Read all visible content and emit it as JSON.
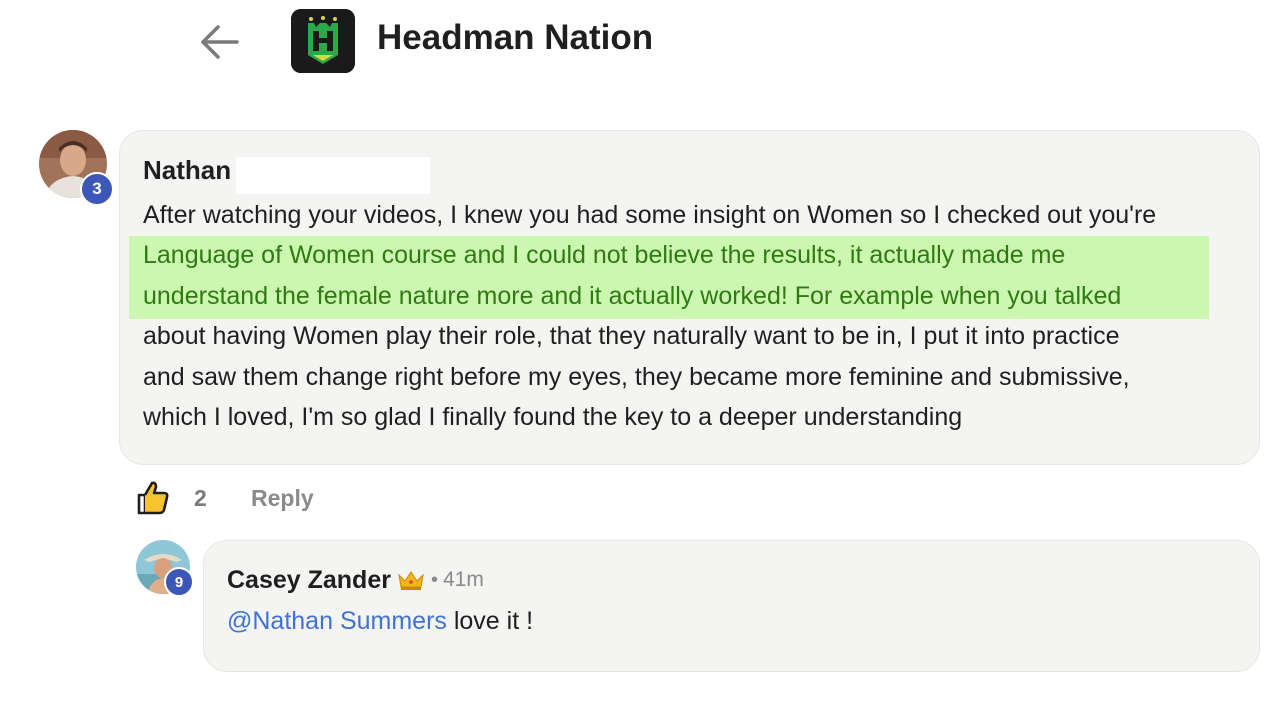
{
  "header": {
    "back_icon": "arrow-left-icon",
    "group_logo_icon": "headman-nation-logo",
    "title": "Headman Nation"
  },
  "comment": {
    "author": "Nathan",
    "level": "3",
    "lines": [
      {
        "text": "After watching your videos, I knew you had some insight on Women so I checked out you're",
        "highlighted": false
      },
      {
        "text": "Language of Women course and I could not believe the results, it actually made me",
        "highlighted": true
      },
      {
        "text": "understand the female nature more and it actually worked! For example when you talked",
        "highlighted": true
      },
      {
        "text": "about having Women play their role, that they naturally want to be in, I put it into practice",
        "highlighted": false
      },
      {
        "text": "and saw them change right before my eyes, they became more feminine and submissive,",
        "highlighted": false
      },
      {
        "text": "which I loved, I'm so glad I finally found the key to a deeper understanding",
        "highlighted": false
      }
    ],
    "highlight_color": "#ccf7b0",
    "like_icon": "thumbs-up-icon",
    "like_count": "2",
    "reply_label": "Reply"
  },
  "reply": {
    "author": "Casey Zander",
    "crown_icon": "crown-icon",
    "separator": "•",
    "time": "41m",
    "level": "9",
    "mention": "@Nathan Summers",
    "text": " love it !"
  },
  "colors": {
    "badge": "#3d57b8",
    "mention": "#3f72d4",
    "bubble": "#f4f4f3"
  }
}
